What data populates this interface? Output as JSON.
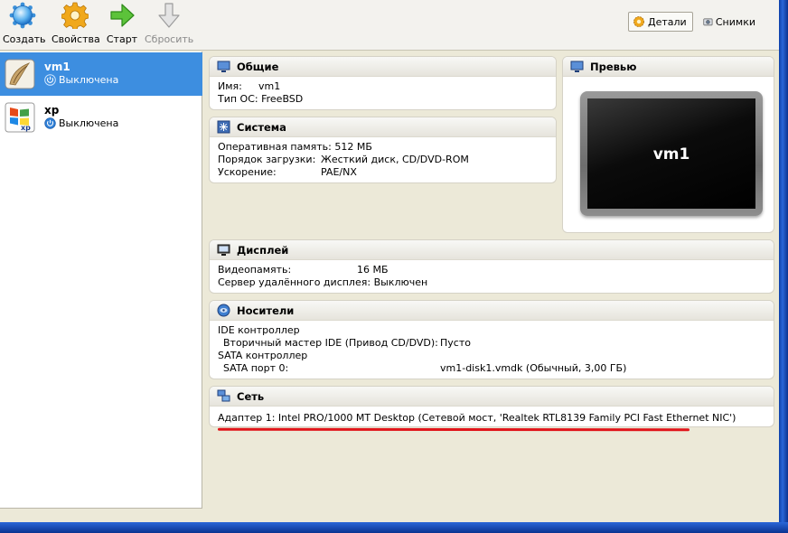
{
  "toolbar": {
    "create_label": "Создать",
    "settings_label": "Свойства",
    "start_label": "Старт",
    "discard_label": "Сбросить",
    "details_label": "Детали",
    "snapshots_label": "Снимки"
  },
  "vms": [
    {
      "name": "vm1",
      "state": "Выключена"
    },
    {
      "name": "xp",
      "state": "Выключена"
    }
  ],
  "general": {
    "title": "Общие",
    "name_label": "Имя:",
    "name_value": "vm1",
    "os_label": "Тип ОС:",
    "os_value": "FreeBSD"
  },
  "system": {
    "title": "Система",
    "ram_label": "Оперативная память:",
    "ram_value": "512 МБ",
    "boot_label": "Порядок загрузки:",
    "boot_value": "Жесткий диск, CD/DVD-ROM",
    "accel_label": "Ускорение:",
    "accel_value": "PAE/NX"
  },
  "preview": {
    "title": "Превью",
    "screen_text": "vm1"
  },
  "display": {
    "title": "Дисплей",
    "vram_label": "Видеопамять:",
    "vram_value": "16 МБ",
    "rdp_label": "Сервер удалённого дисплея:",
    "rdp_value": "Выключен"
  },
  "storage": {
    "title": "Носители",
    "ide_controller": "IDE контроллер",
    "ide_slot_label": "Вторичный мастер IDE (Привод CD/DVD):",
    "ide_slot_value": "Пусто",
    "sata_controller": "SATA контроллер",
    "sata_slot_label": "SATA порт 0:",
    "sata_slot_value": "vm1-disk1.vmdk (Обычный, 3,00 ГБ)"
  },
  "network": {
    "title": "Сеть",
    "adapter1": "Адаптер 1: Intel PRO/1000 MT Desktop (Сетевой мост, 'Realtek RTL8139 Family PCI Fast Ethernet NIC')"
  },
  "colors": {
    "selection": "#3d8ee0",
    "annotation_underline": "#e0141a",
    "window_frame": "#2a66d8"
  }
}
